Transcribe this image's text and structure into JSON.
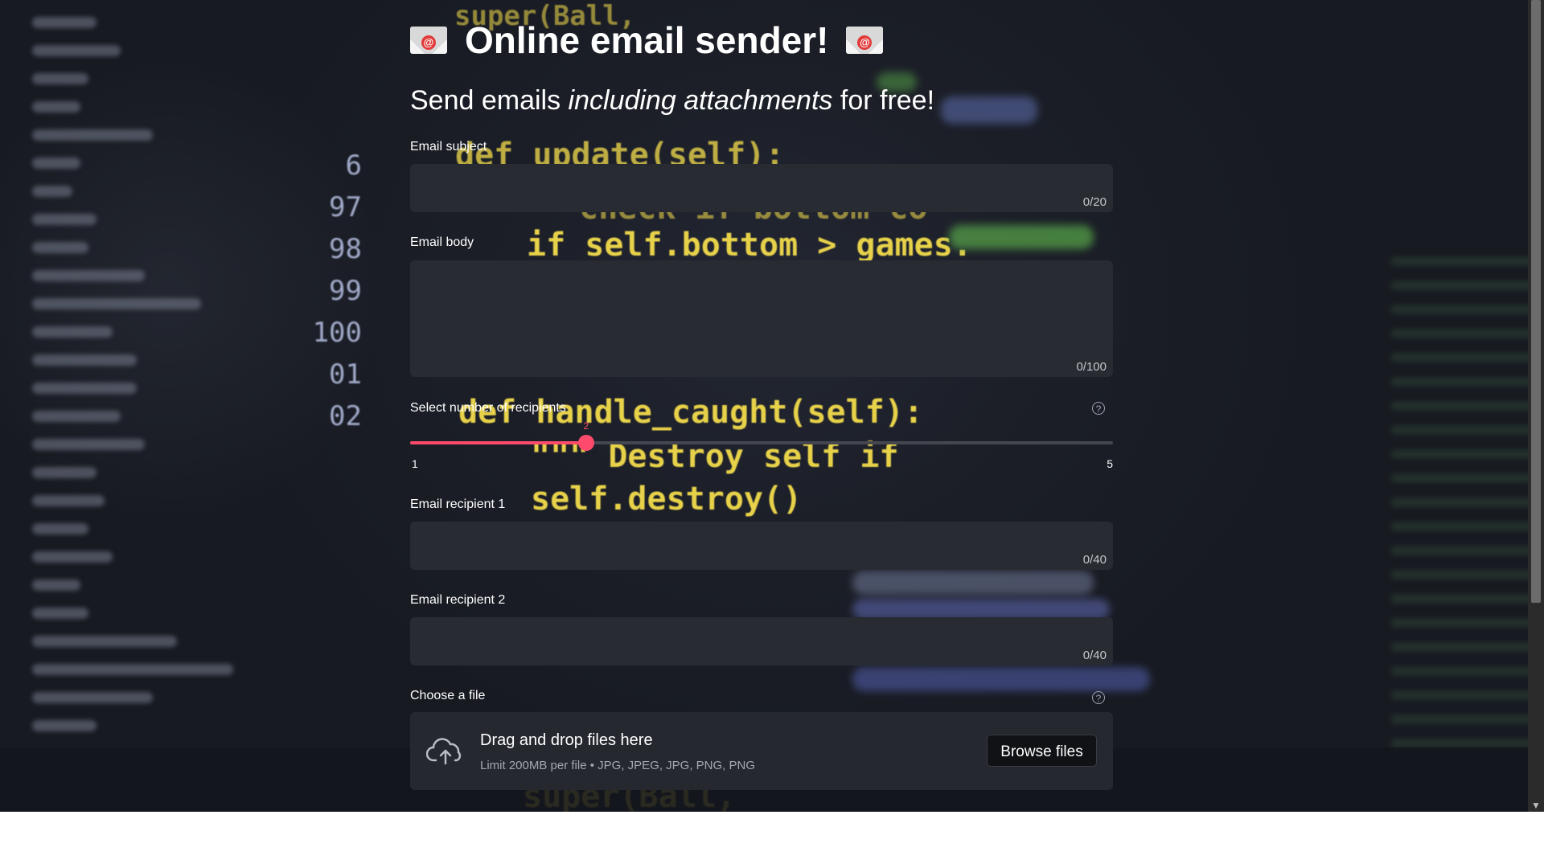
{
  "header": {
    "title": "Online email sender!",
    "subtitle_pre": "Send emails ",
    "subtitle_em": "including attachments",
    "subtitle_post": " for free!"
  },
  "subject": {
    "label": "Email subject",
    "value": "",
    "counter": "0/20"
  },
  "body": {
    "label": "Email body",
    "value": "",
    "counter": "0/100"
  },
  "recipients_slider": {
    "label": "Select number of recipients",
    "value": 2,
    "min": 1,
    "max": 5,
    "min_label": "1",
    "max_label": "5",
    "accent_color": "#ff4b6b"
  },
  "recipients": [
    {
      "label": "Email recipient 1",
      "value": "",
      "counter": "0/40"
    },
    {
      "label": "Email recipient 2",
      "value": "",
      "counter": "0/40"
    }
  ],
  "file_upload": {
    "label": "Choose a file",
    "drop_title": "Drag and drop files here",
    "drop_limit": "Limit 200MB per file • JPG, JPEG, JPG, PNG, PNG",
    "browse_label": "Browse files"
  },
  "help_icon": "question-circle-icon",
  "title_icon": "envelope-icon",
  "upload_icon": "cloud-upload-icon",
  "background_code": {
    "lines": [
      "super(Ball,",
      "def update(self):",
      "check if bottom co",
      "if self.bottom > games.",
      "def handle_caught(self):",
      "\"\"\" Destroy self if",
      "self.destroy()",
      "super(Ball,"
    ],
    "line_numbers": [
      "6",
      "97",
      "98",
      "99",
      "100",
      "01",
      "02"
    ]
  }
}
